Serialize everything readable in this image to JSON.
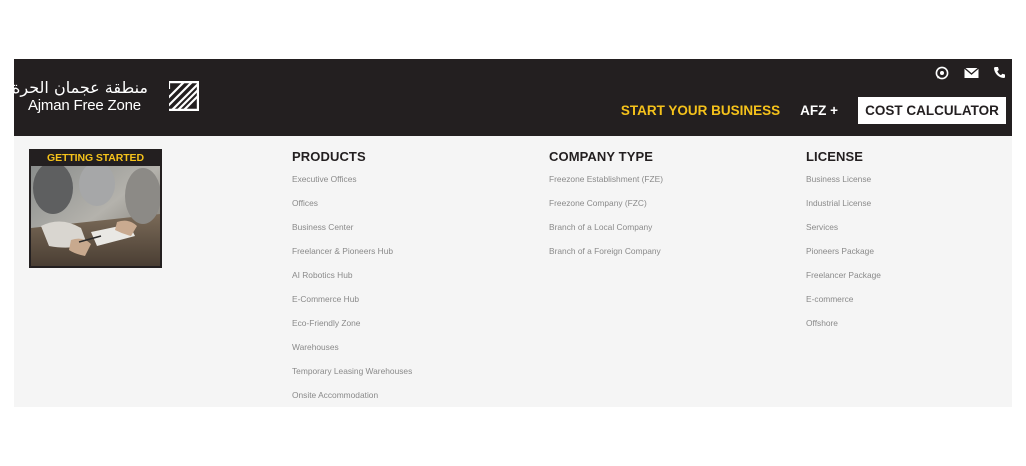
{
  "header": {
    "logo": {
      "arabic": "منطقة عجمان الحرة",
      "english": "Ajman Free Zone",
      "icon": "afz-stripes-logo-icon"
    },
    "top_icons": [
      "whatsapp-icon",
      "mail-icon",
      "phone-icon"
    ],
    "nav": {
      "start_business": "START YOUR BUSINESS",
      "afz_plus": "AFZ +",
      "cost_calculator": "COST CALCULATOR"
    }
  },
  "mega_menu": {
    "getting_started": "GETTING STARTED",
    "columns": [
      {
        "heading": "PRODUCTS",
        "items": [
          "Executive Offices",
          "Offices",
          "Business Center",
          "Freelancer & Pioneers Hub",
          "AI Robotics Hub",
          "E-Commerce Hub",
          "Eco-Friendly Zone",
          "Warehouses",
          "Temporary Leasing Warehouses",
          "Onsite Accommodation"
        ]
      },
      {
        "heading": "COMPANY TYPE",
        "items": [
          "Freezone Establishment (FZE)",
          "Freezone Company (FZC)",
          "Branch of a Local Company",
          "Branch of a Foreign Company"
        ]
      },
      {
        "heading": "LICENSE",
        "items": [
          "Business License",
          "Industrial License",
          "Services",
          "Pioneers Package",
          "Freelancer Package",
          "E-commerce",
          "Offshore"
        ]
      }
    ]
  },
  "colors": {
    "header_bg": "#231f20",
    "accent": "#f5c21b",
    "menu_bg": "#f5f5f5",
    "item_text": "#8a8a8a"
  }
}
